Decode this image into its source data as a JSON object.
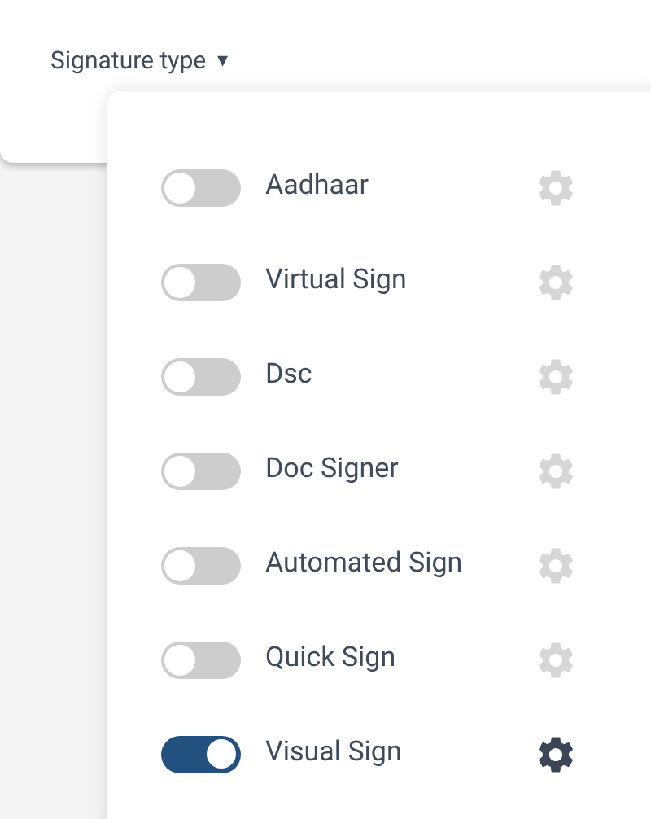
{
  "header": {
    "label": "Signature type",
    "caret": "▾"
  },
  "items": [
    {
      "label": "Aadhaar",
      "on": false
    },
    {
      "label": "Virtual Sign",
      "on": false
    },
    {
      "label": "Dsc",
      "on": false
    },
    {
      "label": "Doc Signer",
      "on": false
    },
    {
      "label": "Automated Sign",
      "on": false
    },
    {
      "label": "Quick Sign",
      "on": false
    },
    {
      "label": "Visual Sign",
      "on": true
    }
  ]
}
